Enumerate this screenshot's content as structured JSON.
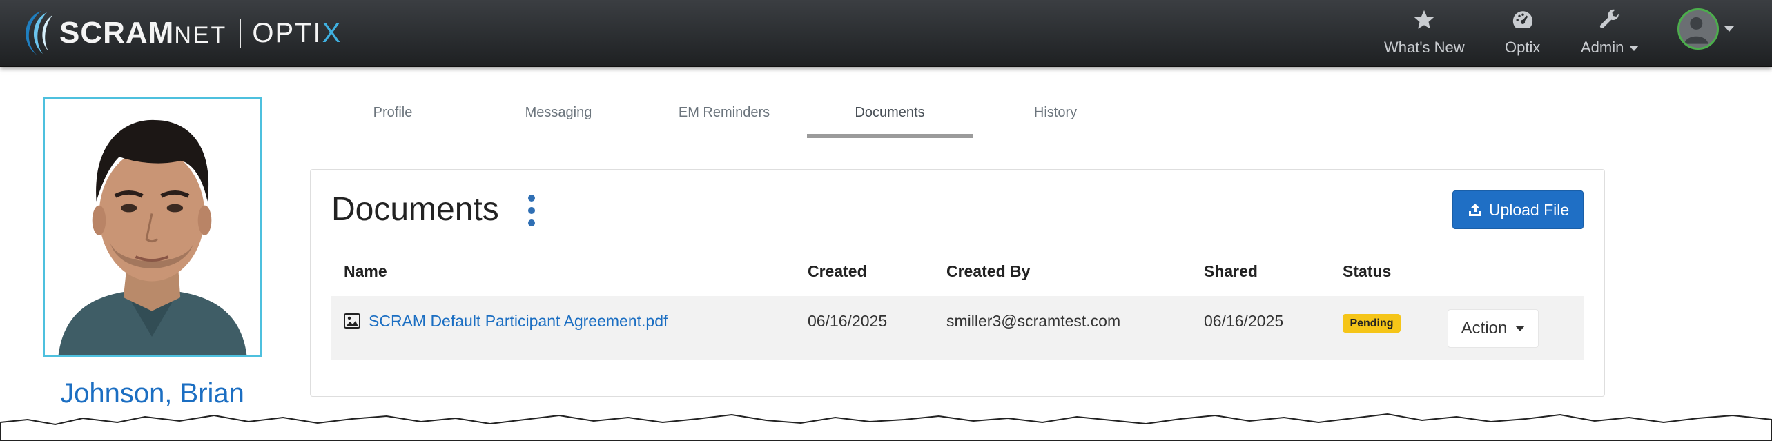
{
  "brand": {
    "name_main": "SCRAM",
    "name_suffix": "NET",
    "product_main": "OPTI",
    "product_accent": "X"
  },
  "nav": {
    "items": [
      {
        "label": "What's New",
        "icon": "star-icon"
      },
      {
        "label": "Optix",
        "icon": "dashboard-icon"
      },
      {
        "label": "Admin",
        "icon": "wrench-icon"
      }
    ],
    "account": {
      "icon": "user-avatar-icon"
    }
  },
  "participant": {
    "name": "Johnson, Brian"
  },
  "tabs": [
    {
      "label": "Profile",
      "active": false
    },
    {
      "label": "Messaging",
      "active": false
    },
    {
      "label": "EM Reminders",
      "active": false
    },
    {
      "label": "Documents",
      "active": true
    },
    {
      "label": "History",
      "active": false
    }
  ],
  "documents": {
    "title": "Documents",
    "upload_label": "Upload File",
    "columns": [
      "Name",
      "Created",
      "Created By",
      "Shared",
      "Status"
    ],
    "rows": [
      {
        "name": "SCRAM Default Participant Agreement.pdf",
        "created": "06/16/2025",
        "created_by": "smiller3@scramtest.com",
        "shared": "06/16/2025",
        "status": "Pending",
        "action_label": "Action"
      }
    ]
  },
  "colors": {
    "navbar": "#2b2e31",
    "link": "#1b6ec2",
    "primary_button": "#1f6fc5",
    "badge_pending": "#f5c518",
    "photo_border": "#4ec0de",
    "avatar_ring": "#4cae4c"
  }
}
